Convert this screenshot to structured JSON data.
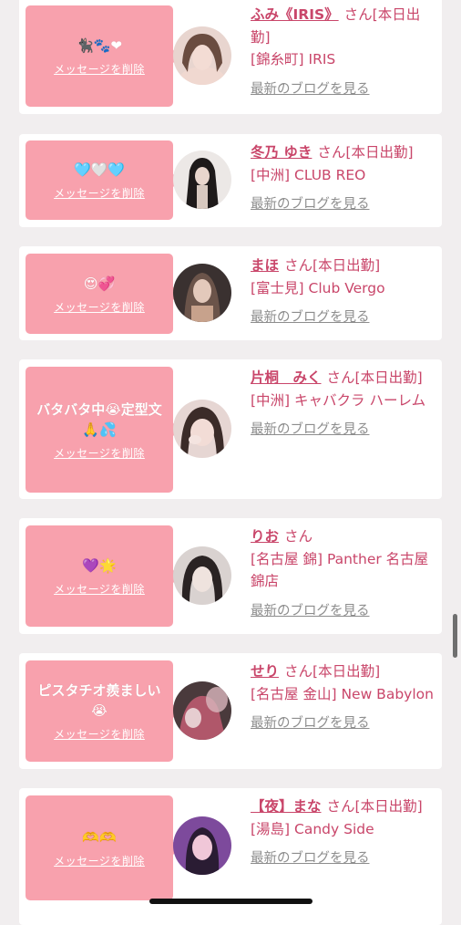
{
  "delete_label": "メッセージを削除",
  "blog_label": "最新のブログを見る",
  "accent_color": "#c9466a",
  "bubble_color": "#f8a1ad",
  "cards": [
    {
      "message": "🐈‍⬛🐾❤",
      "name": "ふみ《IRIS》",
      "suffix": "さん[本日出勤]",
      "shop": "[錦糸町] IRIS",
      "avatar_colors": [
        "#e8d5cf",
        "#6a4c40",
        "#f0d8d0"
      ]
    },
    {
      "message": "🩵🤍🩵",
      "name": "冬乃 ゆき",
      "suffix": "さん[本日出勤]",
      "shop": "[中洲] CLUB REO",
      "avatar_colors": [
        "#ece8e6",
        "#1e1a1a",
        "#d8c9c0"
      ]
    },
    {
      "message": "😍💞",
      "name": "まほ",
      "suffix": "さん[本日出勤]",
      "shop": "[富士見] Club Vergo",
      "avatar_colors": [
        "#3a3130",
        "#c7a28c",
        "#6b544a"
      ]
    },
    {
      "message": "バタバタ中😭定型文🙏💦",
      "name": "片桐　みく",
      "suffix": "さん[本日出勤]",
      "shop": "[中洲] キャバクラ ハーレム",
      "avatar_colors": [
        "#e6d6d3",
        "#3b2b28",
        "#f2dcd6"
      ]
    },
    {
      "message": "💜🌟",
      "name": "りお",
      "suffix": "さん",
      "shop": "[名古屋 錦] Panther 名古屋錦店",
      "avatar_colors": [
        "#d9d2d0",
        "#2a2323",
        "#efe3de"
      ]
    },
    {
      "message": "ピスタチオ羨ましい😭",
      "name": "せり",
      "suffix": "さん[本日出勤]",
      "shop": "[名古屋 金山] New Babylon",
      "avatar_colors": [
        "#4a3a3c",
        "#b0576a",
        "#d9b7bd"
      ]
    },
    {
      "message": "🫶🫶",
      "name": "【夜】まな",
      "suffix": "さん[本日出勤]",
      "shop": "[湯島] Candy Side",
      "avatar_colors": [
        "#7d4a9c",
        "#2a1c33",
        "#f0c7d8"
      ]
    }
  ]
}
